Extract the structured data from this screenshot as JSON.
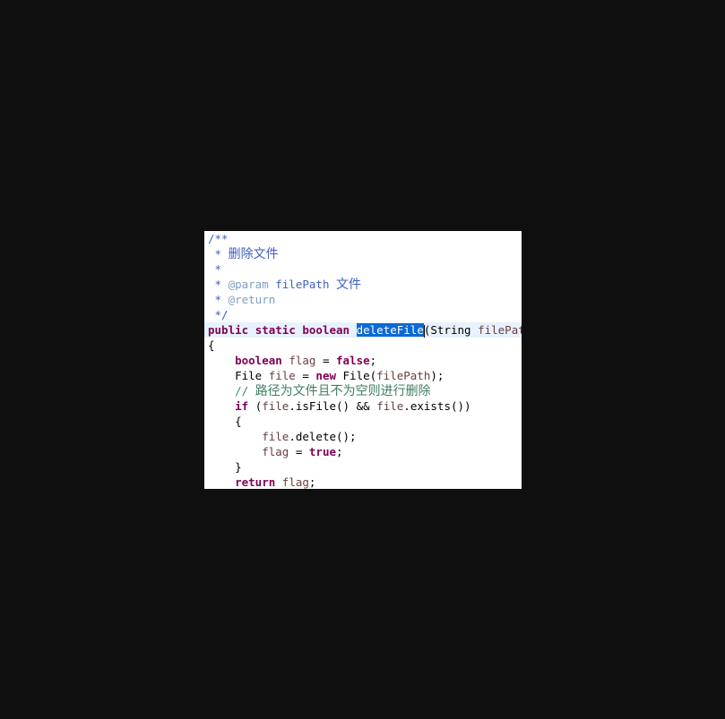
{
  "editor": {
    "lines": [
      {
        "t1": "/**"
      },
      {
        "t1": " * ",
        "t2": "删除文件"
      },
      {
        "t1": " *"
      },
      {
        "t1": " * ",
        "t2": "@param",
        "t3": " filePath ",
        "t4": "文件"
      },
      {
        "t1": " * ",
        "t2": "@return"
      },
      {
        "t1": " */"
      },
      {
        "t1": "public",
        "t2": " ",
        "t3": "static",
        "t4": " ",
        "t5": "boolean",
        "t6": " ",
        "t7": "deleteFile",
        "t8": "(String ",
        "t9": "filePath)"
      },
      {
        "t1": "{"
      },
      {
        "t1": "    ",
        "t2": "boolean",
        "t3": " ",
        "t4": "flag",
        "t5": " = ",
        "t6": "false",
        "t7": ";"
      },
      {
        "t1": "    File ",
        "t2": "file",
        "t3": " = ",
        "t4": "new",
        "t5": " File(",
        "t6": "filePath",
        "t7": ");"
      },
      {
        "t1": "    // ",
        "t2": "路径为文件且不为空则进行删除"
      },
      {
        "t1": "    ",
        "t2": "if",
        "t3": " (",
        "t4": "file",
        "t5": ".isFile() && ",
        "t6": "file",
        "t7": ".exists())"
      },
      {
        "t1": "    {"
      },
      {
        "t1": "        ",
        "t2": "file",
        "t3": ".delete();"
      },
      {
        "t1": "        ",
        "t2": "flag",
        "t3": " = ",
        "t4": "true",
        "t5": ";"
      },
      {
        "t1": "    }"
      },
      {
        "t1": "    ",
        "t2": "return",
        "t3": " ",
        "t4": "flag",
        "t5": ";"
      }
    ]
  }
}
